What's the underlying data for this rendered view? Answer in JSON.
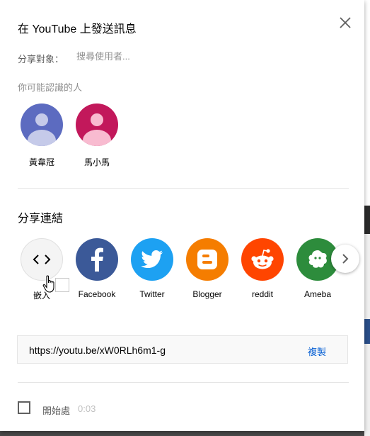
{
  "dialog": {
    "title": "在 YouTube 上發送訊息",
    "share_to_label": "分享對象：",
    "search_placeholder": "搜尋使用者...",
    "suggested_label": "你可能認識的人"
  },
  "contacts": [
    {
      "name": "黃韋冠",
      "color": "#5c6bc0",
      "head_color": "#c5cae9"
    },
    {
      "name": "馬小馬",
      "color": "#c2185b",
      "head_color": "#f8bbd0"
    }
  ],
  "share_link": {
    "section_title": "分享連結",
    "targets": [
      {
        "label": "嵌入",
        "icon": "embed-code-icon",
        "color": "#f4f4f4"
      },
      {
        "label": "Facebook",
        "icon": "facebook-icon",
        "color": "#3b5998"
      },
      {
        "label": "Twitter",
        "icon": "twitter-icon",
        "color": "#1da1f2"
      },
      {
        "label": "Blogger",
        "icon": "blogger-icon",
        "color": "#f57d00"
      },
      {
        "label": "reddit",
        "icon": "reddit-icon",
        "color": "#ff4500"
      },
      {
        "label": "Ameba",
        "icon": "ameba-icon",
        "color": "#2d8c3c"
      }
    ],
    "next_icon": "chevron-right-icon",
    "url": "https://youtu.be/xW0RLh6m1-g",
    "copy_label": "複製"
  },
  "start_at": {
    "label": "開始處",
    "time": "0:03",
    "checked": false
  },
  "colors": {
    "accent": "#065fd4",
    "divider": "#e5e5e5"
  }
}
